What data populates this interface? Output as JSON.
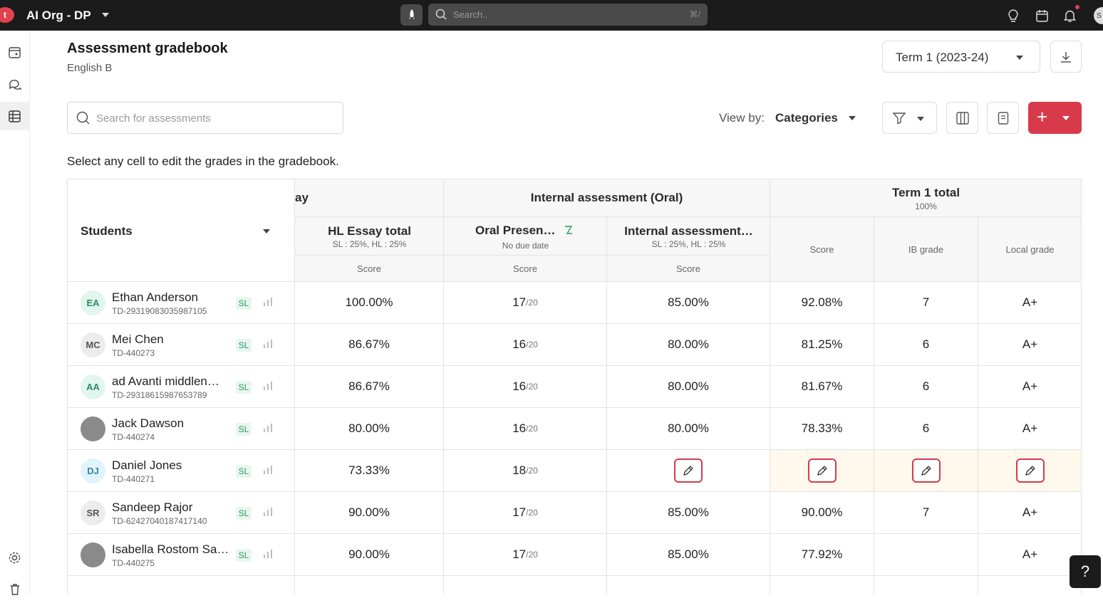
{
  "topbar": {
    "logo_letter": "t",
    "org_name": "AI Org - DP",
    "search_placeholder": "Search..",
    "search_shortcut": "⌘/",
    "avatar_letter": "S"
  },
  "header": {
    "title": "Assessment gradebook",
    "subtitle": "English B",
    "term": "Term 1 (2023-24)"
  },
  "toolbar": {
    "search_placeholder": "Search for assessments",
    "view_by_label": "View by:",
    "view_by_value": "Categories",
    "add_label": "+"
  },
  "hint": "Select any cell to edit the grades in the gradebook.",
  "table": {
    "students_header": "Students",
    "groups": {
      "essay_partial": "ay",
      "internal": "Internal assessment (Oral)",
      "term_total": "Term 1 total",
      "term_total_weight": "100%"
    },
    "columns": {
      "hl_essay": {
        "title": "HL Essay total",
        "sub": "SL : 25%, HL : 25%",
        "score": "Score"
      },
      "oral": {
        "title": "Oral Presen…",
        "sub": "No due date",
        "score": "Score"
      },
      "internal": {
        "title": "Internal assessment…",
        "sub": "SL : 25%, HL : 25%",
        "score": "Score"
      },
      "term_score": "Score",
      "ib_grade": "IB grade",
      "local_grade": "Local grade"
    },
    "rows": [
      {
        "initials": "EA",
        "name": "Ethan Anderson",
        "id": "TD-29319083035987105",
        "level": "SL",
        "hl_essay": "100.00%",
        "oral": "17",
        "oral_max": "/20",
        "internal": "85.00%",
        "term_score": "92.08%",
        "ib": "7",
        "local": "A+"
      },
      {
        "initials": "MC",
        "name": "Mei Chen",
        "id": "TD-440273",
        "level": "SL",
        "hl_essay": "86.67%",
        "oral": "16",
        "oral_max": "/20",
        "internal": "80.00%",
        "term_score": "81.25%",
        "ib": "6",
        "local": "A+"
      },
      {
        "initials": "AA",
        "name": "ad Avanti middlen…",
        "id": "TD-29318615987653789",
        "level": "SL",
        "hl_essay": "86.67%",
        "oral": "16",
        "oral_max": "/20",
        "internal": "80.00%",
        "term_score": "81.67%",
        "ib": "6",
        "local": "A+"
      },
      {
        "initials": "",
        "name": "Jack Dawson",
        "id": "TD-440274",
        "level": "SL",
        "hl_essay": "80.00%",
        "oral": "16",
        "oral_max": "/20",
        "internal": "80.00%",
        "term_score": "78.33%",
        "ib": "6",
        "local": "A+"
      },
      {
        "initials": "DJ",
        "name": "Daniel Jones",
        "id": "TD-440271",
        "level": "SL",
        "hl_essay": "73.33%",
        "oral": "18",
        "oral_max": "/20",
        "internal": "",
        "term_score": "",
        "ib": "",
        "local": ""
      },
      {
        "initials": "SR",
        "name": "Sandeep Rajor",
        "id": "TD-62427040187417140",
        "level": "SL",
        "hl_essay": "90.00%",
        "oral": "17",
        "oral_max": "/20",
        "internal": "85.00%",
        "term_score": "90.00%",
        "ib": "7",
        "local": "A+"
      },
      {
        "initials": "",
        "name": "Isabella Rostom Sa…",
        "id": "TD-440275",
        "level": "SL",
        "hl_essay": "90.00%",
        "oral": "17",
        "oral_max": "/20",
        "internal": "85.00%",
        "term_score": "77.92%",
        "ib": "",
        "local": "A+"
      }
    ]
  },
  "help_label": "?",
  "colors": {
    "accent": "#d83a4b",
    "topbar": "#1b1b1b",
    "highlight_row": "#fff8ec",
    "badge_green": "#2b9a62"
  }
}
